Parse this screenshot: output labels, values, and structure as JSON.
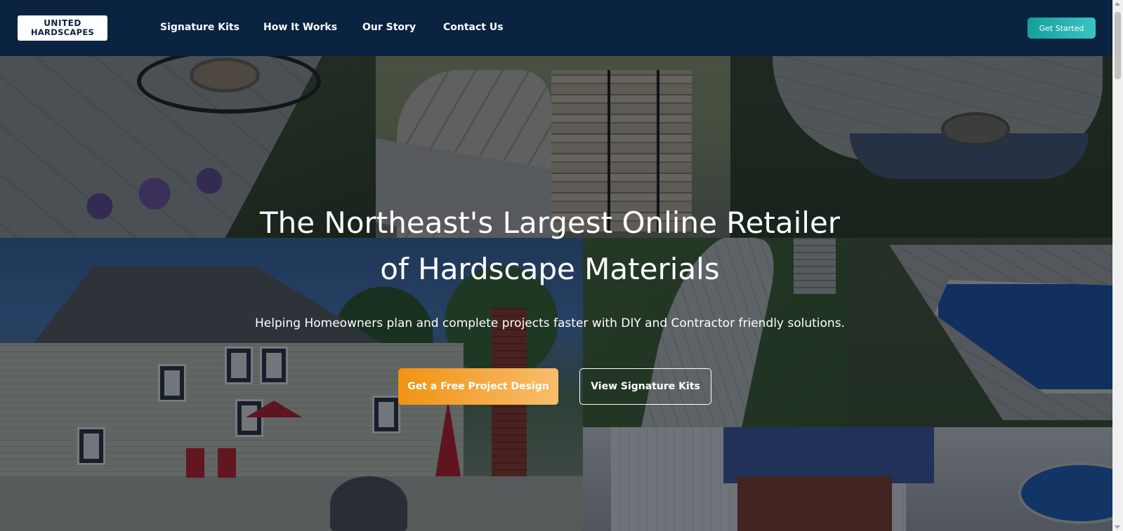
{
  "header": {
    "logo": {
      "line1": "UNITED",
      "line2": "HARDSCAPES"
    },
    "nav": [
      {
        "label": "Signature Kits"
      },
      {
        "label": "How It Works"
      },
      {
        "label": "Our Story"
      },
      {
        "label": "Contact Us"
      }
    ],
    "cta_label": "Get Started"
  },
  "hero": {
    "title_line1": "The Northeast's Largest Online Retailer",
    "title_line2": "of Hardscape Materials",
    "subtitle": "Helping Homeowners plan and complete projects faster with DIY and Contractor friendly solutions.",
    "primary_button": "Get a Free Project Design",
    "secondary_button": "View Signature Kits"
  },
  "colors": {
    "header_bg": "#0a2340",
    "accent_teal": "#1fb0b0",
    "accent_orange": "#f09312"
  },
  "icons": [
    "scroll-up-arrow-icon",
    "scroll-down-arrow-icon"
  ]
}
